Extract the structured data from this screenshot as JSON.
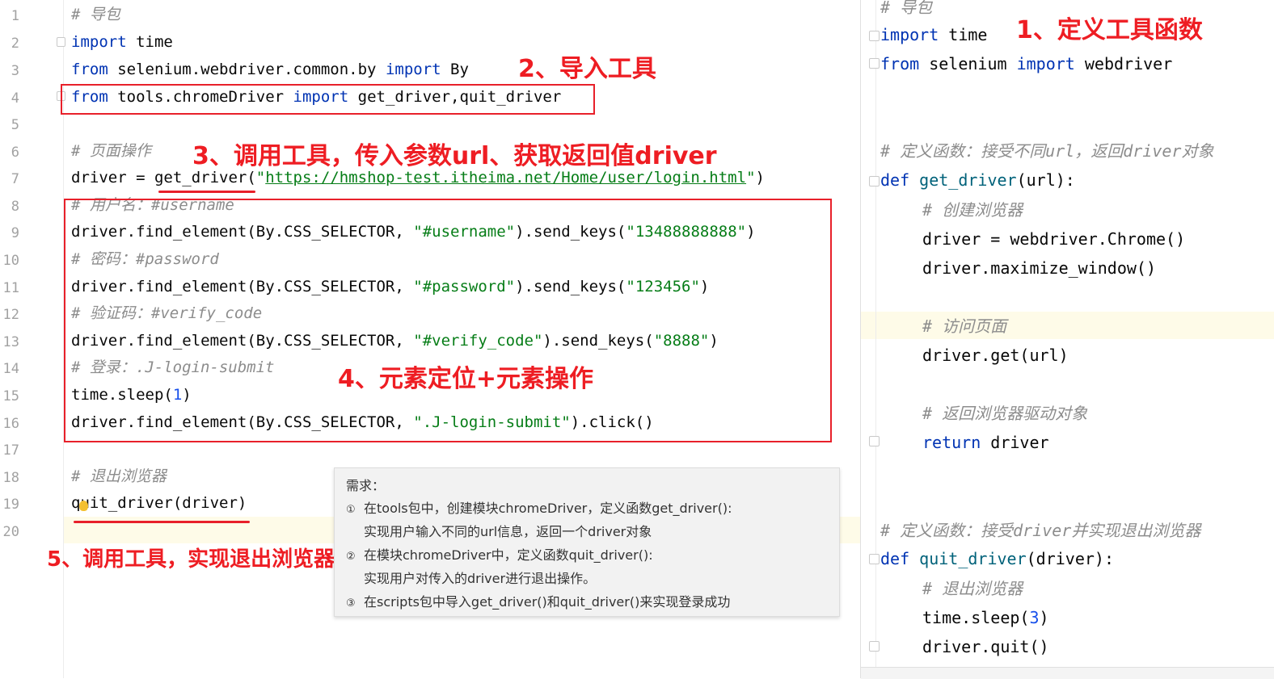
{
  "left_editor": {
    "line_numbers": [
      "1",
      "2",
      "3",
      "4",
      "5",
      "6",
      "7",
      "8",
      "9",
      "10",
      "11",
      "12",
      "13",
      "14",
      "15",
      "16",
      "17",
      "18",
      "19",
      "20"
    ],
    "lines": [
      {
        "tokens": [
          {
            "t": "# 导包",
            "c": "cm"
          }
        ]
      },
      {
        "tokens": [
          {
            "t": "import",
            "c": "kw"
          },
          {
            "t": " time",
            "c": ""
          }
        ]
      },
      {
        "tokens": [
          {
            "t": "from",
            "c": "kw"
          },
          {
            "t": " selenium.webdriver.common.by ",
            "c": ""
          },
          {
            "t": "import",
            "c": "kw"
          },
          {
            "t": " By",
            "c": ""
          }
        ]
      },
      {
        "tokens": [
          {
            "t": "from",
            "c": "kw"
          },
          {
            "t": " tools.chromeDriver ",
            "c": ""
          },
          {
            "t": "import",
            "c": "kw"
          },
          {
            "t": " get_driver,quit_driver",
            "c": ""
          }
        ]
      },
      {
        "tokens": []
      },
      {
        "tokens": [
          {
            "t": "# 页面操作",
            "c": "cm"
          }
        ]
      },
      {
        "tokens": [
          {
            "t": "driver = get_driver(",
            "c": ""
          },
          {
            "t": "\"",
            "c": "st"
          },
          {
            "t": "https://hmshop-test.itheima.net/Home/user/login.html",
            "c": "st ul"
          },
          {
            "t": "\"",
            "c": "st"
          },
          {
            "t": ")",
            "c": ""
          }
        ]
      },
      {
        "tokens": [
          {
            "t": "# 用户名：#username",
            "c": "cm"
          }
        ]
      },
      {
        "tokens": [
          {
            "t": "driver.find_element(By.CSS_SELECTOR, ",
            "c": ""
          },
          {
            "t": "\"#username\"",
            "c": "st"
          },
          {
            "t": ").send_keys(",
            "c": ""
          },
          {
            "t": "\"13488888888\"",
            "c": "st"
          },
          {
            "t": ")",
            "c": ""
          }
        ]
      },
      {
        "tokens": [
          {
            "t": "# 密码：#password",
            "c": "cm"
          }
        ]
      },
      {
        "tokens": [
          {
            "t": "driver.find_element(By.CSS_SELECTOR, ",
            "c": ""
          },
          {
            "t": "\"#password\"",
            "c": "st"
          },
          {
            "t": ").send_keys(",
            "c": ""
          },
          {
            "t": "\"123456\"",
            "c": "st"
          },
          {
            "t": ")",
            "c": ""
          }
        ]
      },
      {
        "tokens": [
          {
            "t": "# 验证码：#verify_code",
            "c": "cm"
          }
        ]
      },
      {
        "tokens": [
          {
            "t": "driver.find_element(By.CSS_SELECTOR, ",
            "c": ""
          },
          {
            "t": "\"#verify_code\"",
            "c": "st"
          },
          {
            "t": ").send_keys(",
            "c": ""
          },
          {
            "t": "\"8888\"",
            "c": "st"
          },
          {
            "t": ")",
            "c": ""
          }
        ]
      },
      {
        "tokens": [
          {
            "t": "# 登录：.J-login-submit",
            "c": "cm"
          }
        ]
      },
      {
        "tokens": [
          {
            "t": "time.sleep(",
            "c": ""
          },
          {
            "t": "1",
            "c": "nm"
          },
          {
            "t": ")",
            "c": ""
          }
        ]
      },
      {
        "tokens": [
          {
            "t": "driver.find_element(By.CSS_SELECTOR, ",
            "c": ""
          },
          {
            "t": "\".J-login-submit\"",
            "c": "st"
          },
          {
            "t": ").click()",
            "c": ""
          }
        ]
      },
      {
        "tokens": []
      },
      {
        "tokens": [
          {
            "t": "# 退出浏览器",
            "c": "cm"
          }
        ]
      },
      {
        "tokens": [
          {
            "t": "quit_driver(driver)",
            "c": ""
          }
        ]
      },
      {
        "tokens": []
      }
    ]
  },
  "annotations": {
    "a1": "1、定义工具函数",
    "a2": "2、导入工具",
    "a3": "3、调用工具，传入参数url、获取返回值driver",
    "a4": "4、元素定位+元素操作",
    "a5": "5、调用工具，实现退出浏览器"
  },
  "tooltip": {
    "title": "需求：",
    "lines": [
      {
        "num": "①",
        "text": "在tools包中，创建模块chromeDriver，定义函数get_driver():"
      },
      {
        "num": "",
        "text": "实现用户输入不同的url信息，返回一个driver对象"
      },
      {
        "num": "②",
        "text": "在模块chromeDriver中，定义函数quit_driver():"
      },
      {
        "num": "",
        "text": "实现用户对传入的driver进行退出操作。"
      },
      {
        "num": "③",
        "text": "在scripts包中导入get_driver()和quit_driver()来实现登录成功"
      }
    ]
  },
  "right_editor": {
    "lines": [
      {
        "tokens": [
          {
            "t": "# 导包",
            "c": "cm"
          }
        ]
      },
      {
        "tokens": [
          {
            "t": "import",
            "c": "kw"
          },
          {
            "t": " time",
            "c": ""
          }
        ]
      },
      {
        "tokens": [
          {
            "t": "from",
            "c": "kw"
          },
          {
            "t": " selenium ",
            "c": ""
          },
          {
            "t": "import",
            "c": "kw"
          },
          {
            "t": " webdriver",
            "c": ""
          }
        ]
      },
      {
        "tokens": [
          {
            "t": "# 定义函数：接受不同url，返回driver对象",
            "c": "cm"
          }
        ]
      },
      {
        "tokens": [
          {
            "t": "def",
            "c": "kw"
          },
          {
            "t": " ",
            "c": ""
          },
          {
            "t": "get_driver",
            "c": "fn"
          },
          {
            "t": "(url):",
            "c": ""
          }
        ]
      },
      {
        "tokens": [
          {
            "t": "# 创建浏览器",
            "c": "cm"
          }
        ]
      },
      {
        "tokens": [
          {
            "t": "driver = webdriver.Chrome()",
            "c": ""
          }
        ]
      },
      {
        "tokens": [
          {
            "t": "driver.maximize_window()",
            "c": ""
          }
        ]
      },
      {
        "tokens": [
          {
            "t": "# 访问页面",
            "c": "cm"
          }
        ]
      },
      {
        "tokens": [
          {
            "t": "driver.get(url)",
            "c": ""
          }
        ]
      },
      {
        "tokens": [
          {
            "t": "# 返回浏览器驱动对象",
            "c": "cm"
          }
        ]
      },
      {
        "tokens": [
          {
            "t": "return",
            "c": "kw"
          },
          {
            "t": " driver",
            "c": ""
          }
        ]
      },
      {
        "tokens": [
          {
            "t": "# 定义函数：接受driver并实现退出浏览器",
            "c": "cm"
          }
        ]
      },
      {
        "tokens": [
          {
            "t": "def",
            "c": "kw"
          },
          {
            "t": " ",
            "c": ""
          },
          {
            "t": "quit_driver",
            "c": "fn"
          },
          {
            "t": "(driver):",
            "c": ""
          }
        ]
      },
      {
        "tokens": [
          {
            "t": "# 退出浏览器",
            "c": "cm"
          }
        ]
      },
      {
        "tokens": [
          {
            "t": "time.sleep(",
            "c": ""
          },
          {
            "t": "3",
            "c": "nm"
          },
          {
            "t": ")",
            "c": ""
          }
        ]
      },
      {
        "tokens": [
          {
            "t": "driver.quit()",
            "c": ""
          }
        ]
      }
    ]
  }
}
